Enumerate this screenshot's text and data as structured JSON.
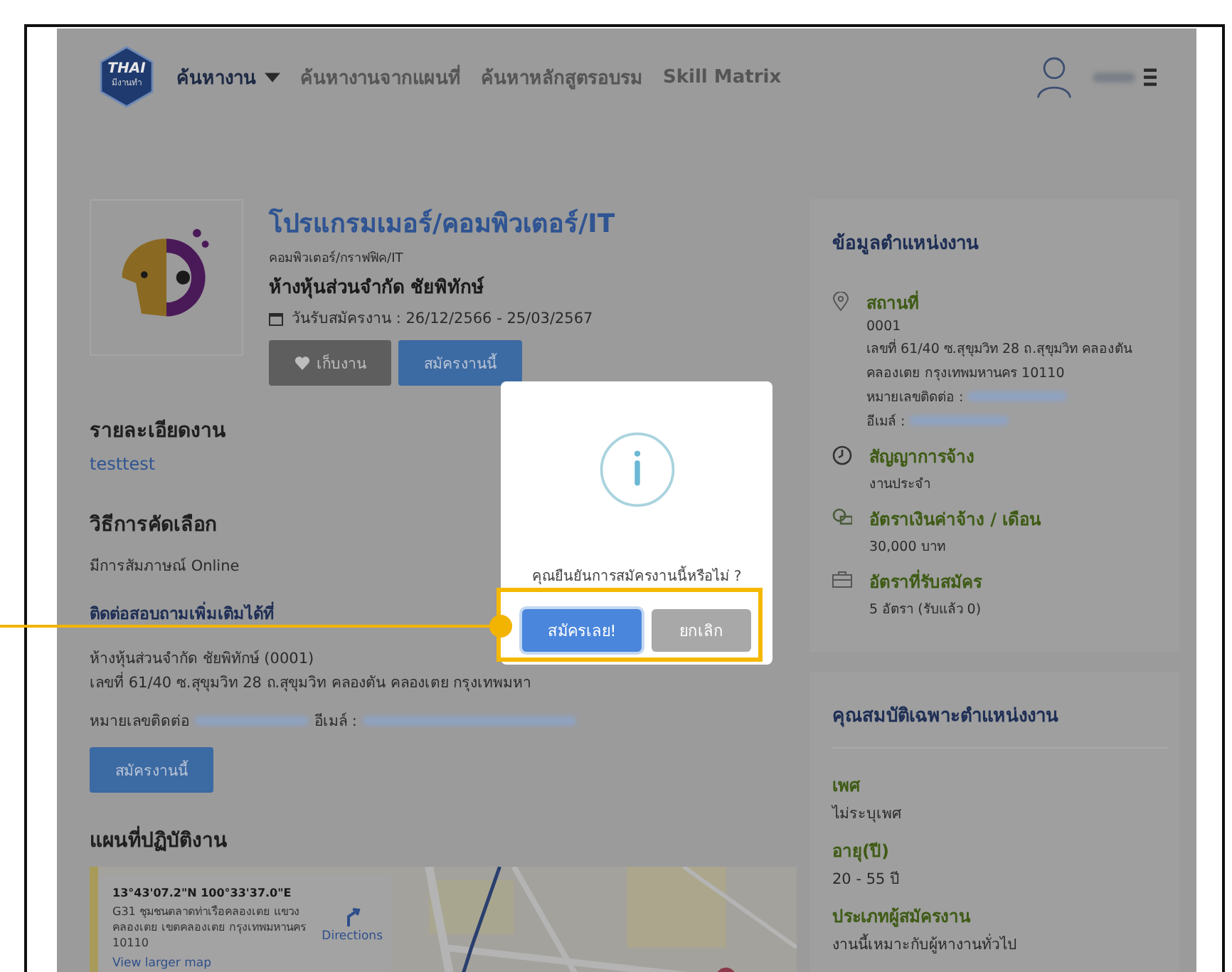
{
  "navbar": {
    "logo": {
      "text": "THAI",
      "subtext": "มีงานทำ"
    },
    "menu": [
      {
        "label": "ค้นหางาน",
        "selected": true,
        "dropdown": true
      },
      {
        "label": "ค้นหางานจากแผนที่",
        "selected": false,
        "dropdown": false
      },
      {
        "label": "ค้นหาหลักสูตรอบรม",
        "selected": false,
        "dropdown": false
      },
      {
        "label": "Skill Matrix",
        "selected": false,
        "dropdown": false
      }
    ],
    "user": {
      "name_redacted": true
    }
  },
  "job": {
    "title": "โปรแกรมเมอร์/คอมพิวเตอร์/IT",
    "category": "คอมพิวเตอร์/กราฟฟิค/IT",
    "company": "ห้างหุ้นส่วนจำกัด ชัยพิทักษ์",
    "dates": "วันรับสมัครงาน : 26/12/2566 - 25/03/2567",
    "save_button": "เก็บงาน",
    "apply_button": "สมัครงานนี้"
  },
  "description": {
    "heading": "รายละเอียดงาน",
    "text": "testtest"
  },
  "selection": {
    "heading": "วิธีการคัดเลือก",
    "text": "มีการสัมภาษณ์ Online"
  },
  "contact": {
    "heading": "ติดต่อสอบถามเพิ่มเติมได้ที่",
    "company": "ห้างหุ้นส่วนจำกัด ชัยพิทักษ์ (0001)",
    "address": "เลขที่ 61/40 ซ.สุขุมวิท 28 ถ.สุขุมวิท คลองตัน คลองเตย กรุงเทพมหา",
    "phone_label": "หมายเลขติดต่อ",
    "email_label": "อีเมล์ :",
    "redacted": true,
    "apply_button": "สมัครงานนี้"
  },
  "map_section": {
    "heading": "แผนที่ปฏิบัติงาน",
    "place_card": {
      "coordinates": "13°43'07.2\"N 100°33'37.0\"E",
      "address": "G31 ชุมชนตลาดท่าเรือคลองเตย แขวง คลองเตย เขตคลองเตย กรุงเทพมหานคร 10110",
      "directions": "Directions",
      "larger_map_link": "View larger map"
    }
  },
  "position_info": {
    "heading": "ข้อมูลตำแหน่งงาน",
    "items": [
      {
        "kind": "location",
        "label": "สถานที่",
        "lines": [
          {
            "text": "0001",
            "redacted": false
          },
          {
            "text": "เลขที่ 61/40 ซ.สุขุมวิท 28 ถ.สุขุมวิท คลองตัน",
            "redacted": false
          },
          {
            "text": "คลองเตย กรุงเทพมหานคร 10110",
            "redacted": false
          },
          {
            "text": "หมายเลขติดต่อ :",
            "redacted": true
          },
          {
            "text": "อีเมล์ :",
            "redacted": true
          }
        ]
      },
      {
        "kind": "contract",
        "label": "สัญญาการจ้าง",
        "lines": [
          {
            "text": "งานประจำ",
            "redacted": false
          }
        ]
      },
      {
        "kind": "salary",
        "label": "อัตราเงินค่าจ้าง / เดือน",
        "lines": [
          {
            "text": "30,000 บาท",
            "redacted": false
          }
        ]
      },
      {
        "kind": "openings",
        "label": "อัตราที่รับสมัคร",
        "lines": [
          {
            "text": "5 อัตรา (รับแล้ว 0)",
            "redacted": false
          }
        ]
      }
    ]
  },
  "qualifications": {
    "heading": "คุณสมบัติเฉพาะตำแหน่งงาน",
    "items": [
      {
        "label": "เพศ",
        "value": "ไม่ระบุเพศ"
      },
      {
        "label": "อายุ(ปี)",
        "value": "20 - 55 ปี"
      },
      {
        "label": "ประเภทผู้สมัครงาน",
        "value": "งานนี้เหมาะกับผู้หางานทั่วไป"
      }
    ]
  },
  "modal": {
    "message": "คุณยืนยันการสมัครงานนี้หรือไม่ ?",
    "buttons": [
      {
        "label": "สมัครเลย!",
        "kind": "confirm",
        "focused": true
      },
      {
        "label": "ยกเลิก",
        "kind": "cancel",
        "focused": false
      }
    ]
  }
}
